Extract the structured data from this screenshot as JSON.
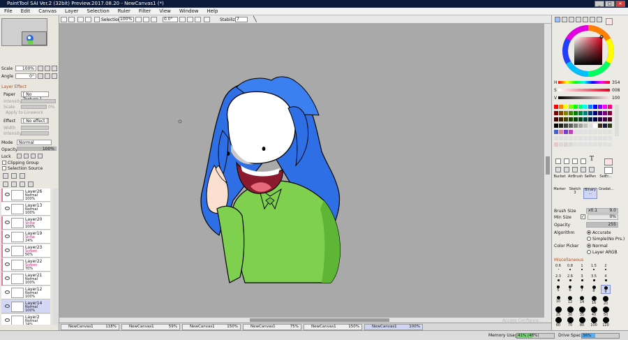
{
  "window": {
    "title": "PaintTool SAI Ver.2 (32bit) Preview.2017.08.20 - NewCanvas1 (*)",
    "minimize": "_",
    "maximize": "□",
    "close": "✕"
  },
  "menu": [
    "File",
    "Edit",
    "Canvas",
    "Layer",
    "Selection",
    "Ruler",
    "Filter",
    "View",
    "Window",
    "Help"
  ],
  "toolbar": {
    "selection_label": "Selection",
    "zoom": "100%",
    "rotation": "0.0°",
    "stabilizer_label": "Stabilizer",
    "stabilizer_value": "7"
  },
  "navigator": {
    "scale_label": "Scale",
    "scale_value": "100%",
    "angle_label": "Angle",
    "angle_value": "0°"
  },
  "layer_effect": {
    "header": "Layer Effect",
    "paper_label": "Paper",
    "paper_value": "[ No Texture ]",
    "intensity_label": "Intensity",
    "scale_label": "Scale",
    "scale_value": "0%",
    "apply_lineworks": "Apply to Linework",
    "effect_label": "Effect",
    "effect_value": "[ No effect ]",
    "width_label": "Width",
    "intensity2_label": "Intensity"
  },
  "layer_props": {
    "mode_label": "Mode",
    "mode_value": "Normal",
    "opacity_label": "Opacity",
    "opacity_value": "100%",
    "lock_label": "Lock",
    "clipping_group": "Clipping Group",
    "selection_source": "Selection Source"
  },
  "layers": [
    {
      "name": "Layer26",
      "mode": "Normal",
      "opacity": "100%",
      "pink": true,
      "selected": false
    },
    {
      "name": "Layer13",
      "mode": "Normal",
      "opacity": "100%",
      "pink": false,
      "selected": false
    },
    {
      "name": "Layer20",
      "mode": "Shine",
      "opacity": "100%",
      "pink": true,
      "selected": false
    },
    {
      "name": "Layer19",
      "mode": "Shine",
      "opacity": "24%",
      "pink": true,
      "selected": false
    },
    {
      "name": "Layer23",
      "mode": "Screen",
      "opacity": "50%",
      "pink": true,
      "selected": false
    },
    {
      "name": "Layer22",
      "mode": "Screen",
      "opacity": "70%",
      "pink": true,
      "selected": false
    },
    {
      "name": "Layer21",
      "mode": "Normal",
      "opacity": "100%",
      "pink": true,
      "selected": false
    },
    {
      "name": "Layer12",
      "mode": "Normal",
      "opacity": "100%",
      "pink": false,
      "selected": false
    },
    {
      "name": "Layer14",
      "mode": "Normal",
      "opacity": "100%",
      "pink": false,
      "selected": true
    },
    {
      "name": "Layer2",
      "mode": "Normal",
      "opacity": "24%",
      "pink": false,
      "selected": false
    }
  ],
  "color": {
    "h_label": "H",
    "h_value": "354",
    "s_label": "S",
    "s_value": "008",
    "v_label": "V",
    "v_value": "100",
    "current": "#fde4e6"
  },
  "tools": {
    "text_tool": "T",
    "brushes": [
      {
        "name": "Bucket",
        "size": ""
      },
      {
        "name": "AirBrush",
        "size": ""
      },
      {
        "name": "SelPen",
        "size": ""
      },
      {
        "name": "SelEr...",
        "size": ""
      },
      {
        "name": "Marker",
        "size": ""
      },
      {
        "name": "Sketch",
        "size": "3"
      },
      {
        "name": "Binary ...",
        "size": ""
      },
      {
        "name": "Gradat...",
        "size": ""
      }
    ]
  },
  "brush_settings": {
    "brush_size_label": "Brush Size",
    "brush_size_mult": "x0.1",
    "brush_size_value": "9.0",
    "min_size_label": "Min Size",
    "min_size_value": "0%",
    "opacity_label": "Opacity",
    "opacity_value": "255",
    "algorithm_label": "Algorithm",
    "algorithm_accurate": "Accurate",
    "algorithm_simple": "Simple(No Prs.)",
    "picker_label": "Color Picker",
    "picker_normal": "Normal",
    "picker_layer": "Layer ARGB",
    "misc_label": "Miscellaneous"
  },
  "brush_sizes": [
    "0.6",
    "0.8",
    "1",
    "1.5",
    "2",
    "2.3",
    "2.6",
    "3",
    "3.5",
    "4",
    "5",
    "6",
    "7",
    "8",
    "9",
    "10",
    "12",
    "14",
    "16",
    "20",
    "25",
    "30",
    "35",
    "40",
    "50",
    "60",
    "70",
    "80",
    "100",
    "120"
  ],
  "canvas_tabs": [
    {
      "name": "NewCanvas1",
      "zoom": "118%"
    },
    {
      "name": "NewCanvas1",
      "zoom": "59%"
    },
    {
      "name": "NewCanvas1",
      "zoom": "150%"
    },
    {
      "name": "NewCanvas1",
      "zoom": "75%"
    },
    {
      "name": "NewCanvas1",
      "zoom": "150%"
    },
    {
      "name": "NewCanvas1",
      "zoom": "100%"
    }
  ],
  "status": {
    "memory_label": "Memory Usage",
    "memory_value": "41% (48%)",
    "memory_fraction": 0.41,
    "drive_label": "Drive Space",
    "drive_value": "36%",
    "drive_fraction": 0.36,
    "watermark": "Access Configura..."
  }
}
